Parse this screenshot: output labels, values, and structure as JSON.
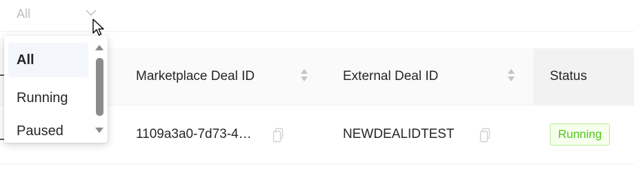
{
  "filter": {
    "value": "All"
  },
  "dropdown": {
    "options": [
      {
        "label": "All",
        "selected": true
      },
      {
        "label": "Running",
        "selected": false
      },
      {
        "label": "Paused",
        "selected": false
      }
    ]
  },
  "table": {
    "columns": [
      {
        "label": "Marketplace Deal ID",
        "sortable": true
      },
      {
        "label": "External Deal ID",
        "sortable": true
      },
      {
        "label": "Status",
        "sortable": false
      }
    ],
    "rows": [
      {
        "marketplace_deal_id": "1109a3a0-7d73-4…",
        "external_deal_id": "NEWDEALIDTEST",
        "status": "Running"
      }
    ]
  },
  "colors": {
    "status_running_text": "#52c41a",
    "status_running_bg": "#f6ffed",
    "status_running_border": "#b7eb8f",
    "header_bg": "#fafafa",
    "selected_option_bg": "#f3f6fb"
  },
  "icons": {
    "filter_chevron": "chevron-down-icon",
    "sort": "sort-icon",
    "copy": "copy-icon",
    "cursor": "mouse-cursor-icon"
  }
}
